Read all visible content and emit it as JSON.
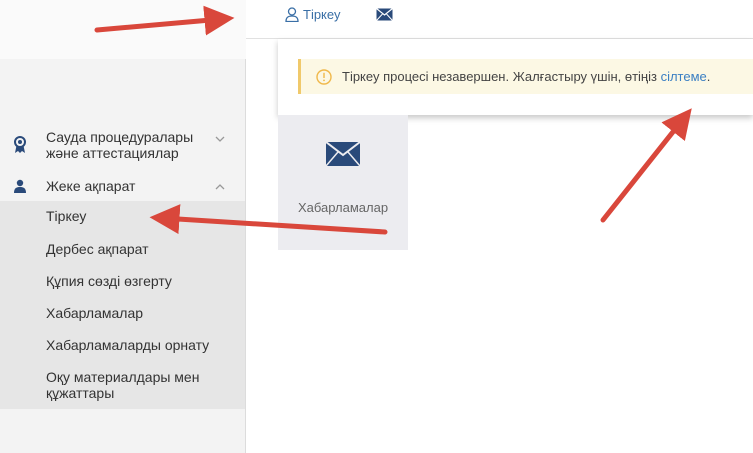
{
  "topbar": {
    "register_label": "Тіркеу",
    "register_icon": "user-icon",
    "messages_icon": "envelope-icon",
    "link_color": "#3a6fa6"
  },
  "sidebar": {
    "items": [
      {
        "label": "Сауда процедуралары және аттестациялар",
        "icon": "award-ribbon-icon",
        "expanded": false
      },
      {
        "label": "Жеке ақпарат",
        "icon": "person-icon",
        "expanded": true
      }
    ],
    "submenu": [
      {
        "label": "Тіркеу"
      },
      {
        "label": "Дербес ақпарат"
      },
      {
        "label": "Құпия сөзді өзгерту"
      },
      {
        "label": "Хабарламалар"
      },
      {
        "label": "Хабарламаларды орнату"
      },
      {
        "label": "Оқу материалдары мен құжаттары"
      }
    ]
  },
  "alert": {
    "text": "Тіркеу процесі незавершен. Жалғастыру үшін, өтіңіз ",
    "link_label": "сілтеме",
    "suffix": ".",
    "icon": "warning-circle-icon",
    "background": "#fcf8e4",
    "border_color": "#f0c96b"
  },
  "tile": {
    "label": "Хабарламалар",
    "icon": "envelope-icon"
  },
  "annotation": {
    "arrow_color": "#d9473b"
  }
}
